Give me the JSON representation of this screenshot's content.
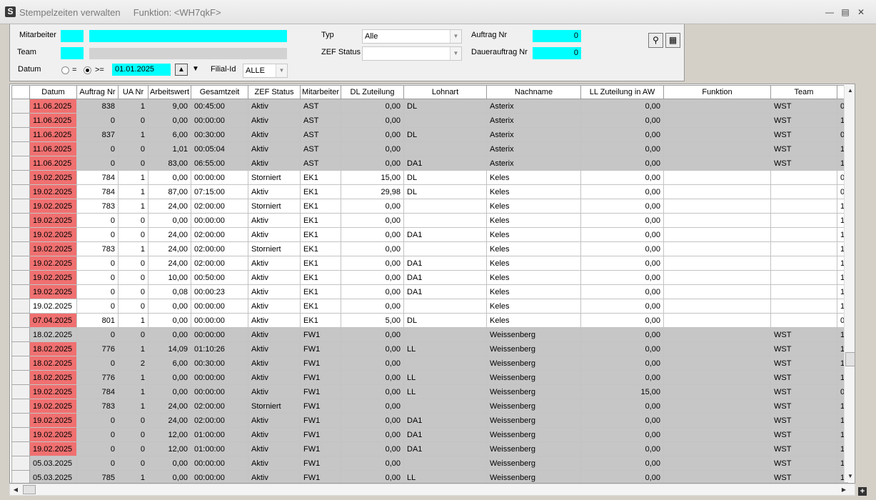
{
  "window": {
    "title": "Stempelzeiten verwalten",
    "subtitle": "Funktion: <WH7qkF>",
    "icon_name": "app-icon",
    "app_glyph": "S"
  },
  "filters": {
    "mitarbeiter_label": "Mitarbeiter",
    "team_label": "Team",
    "datum_label": "Datum",
    "radio_eq_label": "=",
    "radio_ge_label": ">=",
    "date_value": "01.01.2025",
    "filial_label": "Filial-Id",
    "filial_value": "ALLE",
    "typ_label": "Typ",
    "typ_value": "Alle",
    "zef_status_label": "ZEF Status",
    "zef_status_value": "",
    "auftrag_nr_label": "Auftrag Nr",
    "auftrag_nr_value": "0",
    "dauerauftrag_nr_label": "Dauerauftrag Nr",
    "dauerauftrag_nr_value": "0",
    "radio_selected": ">="
  },
  "colors": {
    "highlight_field": "#00ffff",
    "date_flag": "#f07070",
    "row_gray": "#c6c6c6"
  },
  "grid": {
    "columns": [
      "Datum",
      "Auftrag Nr",
      "UA Nr",
      "Arbeitswert",
      "Gesamtzeit",
      "ZEF Status",
      "Mitarbeiter",
      "DL Zuteilung",
      "Lohnart",
      "Nachname",
      "LL Zuteilung in AW",
      "Funktion",
      "Team"
    ],
    "rows": [
      {
        "datum": "11.06.2025",
        "auftrag": "838",
        "ua": "1",
        "aw": "9,00",
        "zeit": "00:45:00",
        "status": "Aktiv",
        "ma": "AST",
        "dl": "0,00",
        "lohnart": "DL",
        "name": "Asterix",
        "ll": "0,00",
        "funktion": "",
        "team": "WST",
        "extra": "0",
        "shade": "gray",
        "red": true
      },
      {
        "datum": "11.06.2025",
        "auftrag": "0",
        "ua": "0",
        "aw": "0,00",
        "zeit": "00:00:00",
        "status": "Aktiv",
        "ma": "AST",
        "dl": "0,00",
        "lohnart": "",
        "name": "Asterix",
        "ll": "0,00",
        "funktion": "",
        "team": "WST",
        "extra": "1",
        "shade": "gray",
        "red": true
      },
      {
        "datum": "11.06.2025",
        "auftrag": "837",
        "ua": "1",
        "aw": "6,00",
        "zeit": "00:30:00",
        "status": "Aktiv",
        "ma": "AST",
        "dl": "0,00",
        "lohnart": "DL",
        "name": "Asterix",
        "ll": "0,00",
        "funktion": "",
        "team": "WST",
        "extra": "0",
        "shade": "gray",
        "red": true
      },
      {
        "datum": "11.06.2025",
        "auftrag": "0",
        "ua": "0",
        "aw": "1,01",
        "zeit": "00:05:04",
        "status": "Aktiv",
        "ma": "AST",
        "dl": "0,00",
        "lohnart": "",
        "name": "Asterix",
        "ll": "0,00",
        "funktion": "",
        "team": "WST",
        "extra": "1",
        "shade": "gray",
        "red": true
      },
      {
        "datum": "11.06.2025",
        "auftrag": "0",
        "ua": "0",
        "aw": "83,00",
        "zeit": "06:55:00",
        "status": "Aktiv",
        "ma": "AST",
        "dl": "0,00",
        "lohnart": "DA1",
        "name": "Asterix",
        "ll": "0,00",
        "funktion": "",
        "team": "WST",
        "extra": "1",
        "shade": "gray",
        "red": true
      },
      {
        "datum": "19.02.2025",
        "auftrag": "784",
        "ua": "1",
        "aw": "0,00",
        "zeit": "00:00:00",
        "status": "Storniert",
        "ma": "EK1",
        "dl": "15,00",
        "lohnart": "DL",
        "name": "Keles",
        "ll": "0,00",
        "funktion": "",
        "team": "",
        "extra": "0",
        "shade": "white",
        "red": true
      },
      {
        "datum": "19.02.2025",
        "auftrag": "784",
        "ua": "1",
        "aw": "87,00",
        "zeit": "07:15:00",
        "status": "Aktiv",
        "ma": "EK1",
        "dl": "29,98",
        "lohnart": "DL",
        "name": "Keles",
        "ll": "0,00",
        "funktion": "",
        "team": "",
        "extra": "0",
        "shade": "white",
        "red": true
      },
      {
        "datum": "19.02.2025",
        "auftrag": "783",
        "ua": "1",
        "aw": "24,00",
        "zeit": "02:00:00",
        "status": "Storniert",
        "ma": "EK1",
        "dl": "0,00",
        "lohnart": "",
        "name": "Keles",
        "ll": "0,00",
        "funktion": "",
        "team": "",
        "extra": "1",
        "shade": "white",
        "red": true
      },
      {
        "datum": "19.02.2025",
        "auftrag": "0",
        "ua": "0",
        "aw": "0,00",
        "zeit": "00:00:00",
        "status": "Aktiv",
        "ma": "EK1",
        "dl": "0,00",
        "lohnart": "",
        "name": "Keles",
        "ll": "0,00",
        "funktion": "",
        "team": "",
        "extra": "1",
        "shade": "white",
        "red": true
      },
      {
        "datum": "19.02.2025",
        "auftrag": "0",
        "ua": "0",
        "aw": "24,00",
        "zeit": "02:00:00",
        "status": "Aktiv",
        "ma": "EK1",
        "dl": "0,00",
        "lohnart": "DA1",
        "name": "Keles",
        "ll": "0,00",
        "funktion": "",
        "team": "",
        "extra": "1",
        "shade": "white",
        "red": true
      },
      {
        "datum": "19.02.2025",
        "auftrag": "783",
        "ua": "1",
        "aw": "24,00",
        "zeit": "02:00:00",
        "status": "Storniert",
        "ma": "EK1",
        "dl": "0,00",
        "lohnart": "",
        "name": "Keles",
        "ll": "0,00",
        "funktion": "",
        "team": "",
        "extra": "1",
        "shade": "white",
        "red": true
      },
      {
        "datum": "19.02.2025",
        "auftrag": "0",
        "ua": "0",
        "aw": "24,00",
        "zeit": "02:00:00",
        "status": "Aktiv",
        "ma": "EK1",
        "dl": "0,00",
        "lohnart": "DA1",
        "name": "Keles",
        "ll": "0,00",
        "funktion": "",
        "team": "",
        "extra": "1",
        "shade": "white",
        "red": true
      },
      {
        "datum": "19.02.2025",
        "auftrag": "0",
        "ua": "0",
        "aw": "10,00",
        "zeit": "00:50:00",
        "status": "Aktiv",
        "ma": "EK1",
        "dl": "0,00",
        "lohnart": "DA1",
        "name": "Keles",
        "ll": "0,00",
        "funktion": "",
        "team": "",
        "extra": "1",
        "shade": "white",
        "red": true
      },
      {
        "datum": "19.02.2025",
        "auftrag": "0",
        "ua": "0",
        "aw": "0,08",
        "zeit": "00:00:23",
        "status": "Aktiv",
        "ma": "EK1",
        "dl": "0,00",
        "lohnart": "DA1",
        "name": "Keles",
        "ll": "0,00",
        "funktion": "",
        "team": "",
        "extra": "1",
        "shade": "white",
        "red": true
      },
      {
        "datum": "19.02.2025",
        "auftrag": "0",
        "ua": "0",
        "aw": "0,00",
        "zeit": "00:00:00",
        "status": "Aktiv",
        "ma": "EK1",
        "dl": "0,00",
        "lohnart": "",
        "name": "Keles",
        "ll": "0,00",
        "funktion": "",
        "team": "",
        "extra": "1",
        "shade": "white",
        "red": false
      },
      {
        "datum": "07.04.2025",
        "auftrag": "801",
        "ua": "1",
        "aw": "0,00",
        "zeit": "00:00:00",
        "status": "Aktiv",
        "ma": "EK1",
        "dl": "5,00",
        "lohnart": "DL",
        "name": "Keles",
        "ll": "0,00",
        "funktion": "",
        "team": "",
        "extra": "0",
        "shade": "white",
        "red": true
      },
      {
        "datum": "18.02.2025",
        "auftrag": "0",
        "ua": "0",
        "aw": "0,00",
        "zeit": "00:00:00",
        "status": "Aktiv",
        "ma": "FW1",
        "dl": "0,00",
        "lohnart": "",
        "name": "Weissenberg",
        "ll": "0,00",
        "funktion": "",
        "team": "WST",
        "extra": "1",
        "shade": "gray",
        "red": false
      },
      {
        "datum": "18.02.2025",
        "auftrag": "776",
        "ua": "1",
        "aw": "14,09",
        "zeit": "01:10:26",
        "status": "Aktiv",
        "ma": "FW1",
        "dl": "0,00",
        "lohnart": "LL",
        "name": "Weissenberg",
        "ll": "0,00",
        "funktion": "",
        "team": "WST",
        "extra": "1",
        "shade": "gray",
        "red": true
      },
      {
        "datum": "18.02.2025",
        "auftrag": "0",
        "ua": "2",
        "aw": "6,00",
        "zeit": "00:30:00",
        "status": "Aktiv",
        "ma": "FW1",
        "dl": "0,00",
        "lohnart": "",
        "name": "Weissenberg",
        "ll": "0,00",
        "funktion": "",
        "team": "WST",
        "extra": "1",
        "shade": "gray",
        "red": true
      },
      {
        "datum": "18.02.2025",
        "auftrag": "776",
        "ua": "1",
        "aw": "0,00",
        "zeit": "00:00:00",
        "status": "Aktiv",
        "ma": "FW1",
        "dl": "0,00",
        "lohnart": "LL",
        "name": "Weissenberg",
        "ll": "0,00",
        "funktion": "",
        "team": "WST",
        "extra": "1",
        "shade": "gray",
        "red": true
      },
      {
        "datum": "19.02.2025",
        "auftrag": "784",
        "ua": "1",
        "aw": "0,00",
        "zeit": "00:00:00",
        "status": "Aktiv",
        "ma": "FW1",
        "dl": "0,00",
        "lohnart": "LL",
        "name": "Weissenberg",
        "ll": "15,00",
        "funktion": "",
        "team": "WST",
        "extra": "0",
        "shade": "gray",
        "red": true
      },
      {
        "datum": "19.02.2025",
        "auftrag": "783",
        "ua": "1",
        "aw": "24,00",
        "zeit": "02:00:00",
        "status": "Storniert",
        "ma": "FW1",
        "dl": "0,00",
        "lohnart": "",
        "name": "Weissenberg",
        "ll": "0,00",
        "funktion": "",
        "team": "WST",
        "extra": "1",
        "shade": "gray",
        "red": true
      },
      {
        "datum": "19.02.2025",
        "auftrag": "0",
        "ua": "0",
        "aw": "24,00",
        "zeit": "02:00:00",
        "status": "Aktiv",
        "ma": "FW1",
        "dl": "0,00",
        "lohnart": "DA1",
        "name": "Weissenberg",
        "ll": "0,00",
        "funktion": "",
        "team": "WST",
        "extra": "1",
        "shade": "gray",
        "red": true
      },
      {
        "datum": "19.02.2025",
        "auftrag": "0",
        "ua": "0",
        "aw": "12,00",
        "zeit": "01:00:00",
        "status": "Aktiv",
        "ma": "FW1",
        "dl": "0,00",
        "lohnart": "DA1",
        "name": "Weissenberg",
        "ll": "0,00",
        "funktion": "",
        "team": "WST",
        "extra": "1",
        "shade": "gray",
        "red": true
      },
      {
        "datum": "19.02.2025",
        "auftrag": "0",
        "ua": "0",
        "aw": "12,00",
        "zeit": "01:00:00",
        "status": "Aktiv",
        "ma": "FW1",
        "dl": "0,00",
        "lohnart": "DA1",
        "name": "Weissenberg",
        "ll": "0,00",
        "funktion": "",
        "team": "WST",
        "extra": "1",
        "shade": "gray",
        "red": true
      },
      {
        "datum": "05.03.2025",
        "auftrag": "0",
        "ua": "0",
        "aw": "0,00",
        "zeit": "00:00:00",
        "status": "Aktiv",
        "ma": "FW1",
        "dl": "0,00",
        "lohnart": "",
        "name": "Weissenberg",
        "ll": "0,00",
        "funktion": "",
        "team": "WST",
        "extra": "1",
        "shade": "gray",
        "red": false
      },
      {
        "datum": "05.03.2025",
        "auftrag": "785",
        "ua": "1",
        "aw": "0,00",
        "zeit": "00:00:00",
        "status": "Aktiv",
        "ma": "FW1",
        "dl": "0,00",
        "lohnart": "LL",
        "name": "Weissenberg",
        "ll": "0,00",
        "funktion": "",
        "team": "WST",
        "extra": "1",
        "shade": "gray",
        "red": false
      }
    ]
  }
}
